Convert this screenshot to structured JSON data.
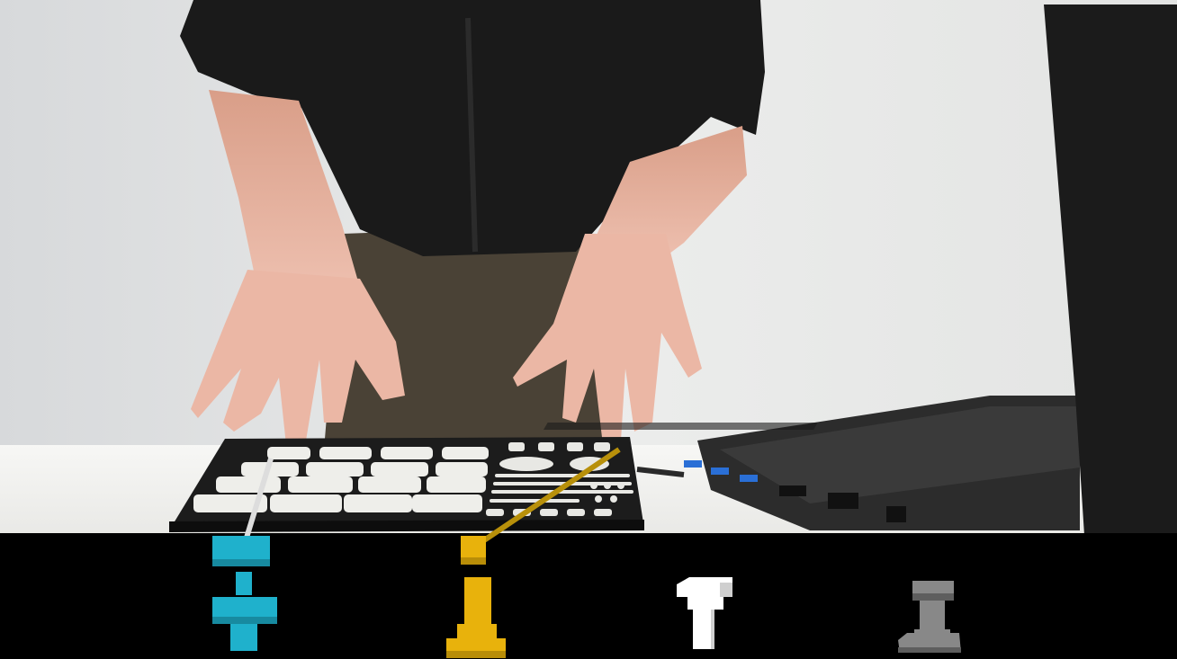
{
  "scene": {
    "subject": "person-playing-pad-controller",
    "colors": {
      "wall": "#e6e6e4",
      "table": "#f2f2f0",
      "sweater": "#1a1a1a",
      "pants": "#4d4538",
      "skin": "#e8b4a4",
      "controller_body": "#1c1c1c",
      "pad": "#eeeeea",
      "laptop": "#2a2a2a",
      "viz_panel": "#000000"
    }
  },
  "visualization": {
    "markers": [
      {
        "name": "cyan-marker",
        "color": "#1fb1cc",
        "icon": "cross-stack-icon"
      },
      {
        "name": "yellow-marker",
        "color": "#e8b20c",
        "icon": "pedestal-stack-icon"
      },
      {
        "name": "white-marker",
        "color": "#ffffff",
        "icon": "t-stack-icon"
      },
      {
        "name": "gray-marker",
        "color": "#888888",
        "icon": "i-beam-stack-icon"
      }
    ],
    "connectors": [
      {
        "color": "#dddddd"
      },
      {
        "color": "#b8900a"
      }
    ]
  }
}
